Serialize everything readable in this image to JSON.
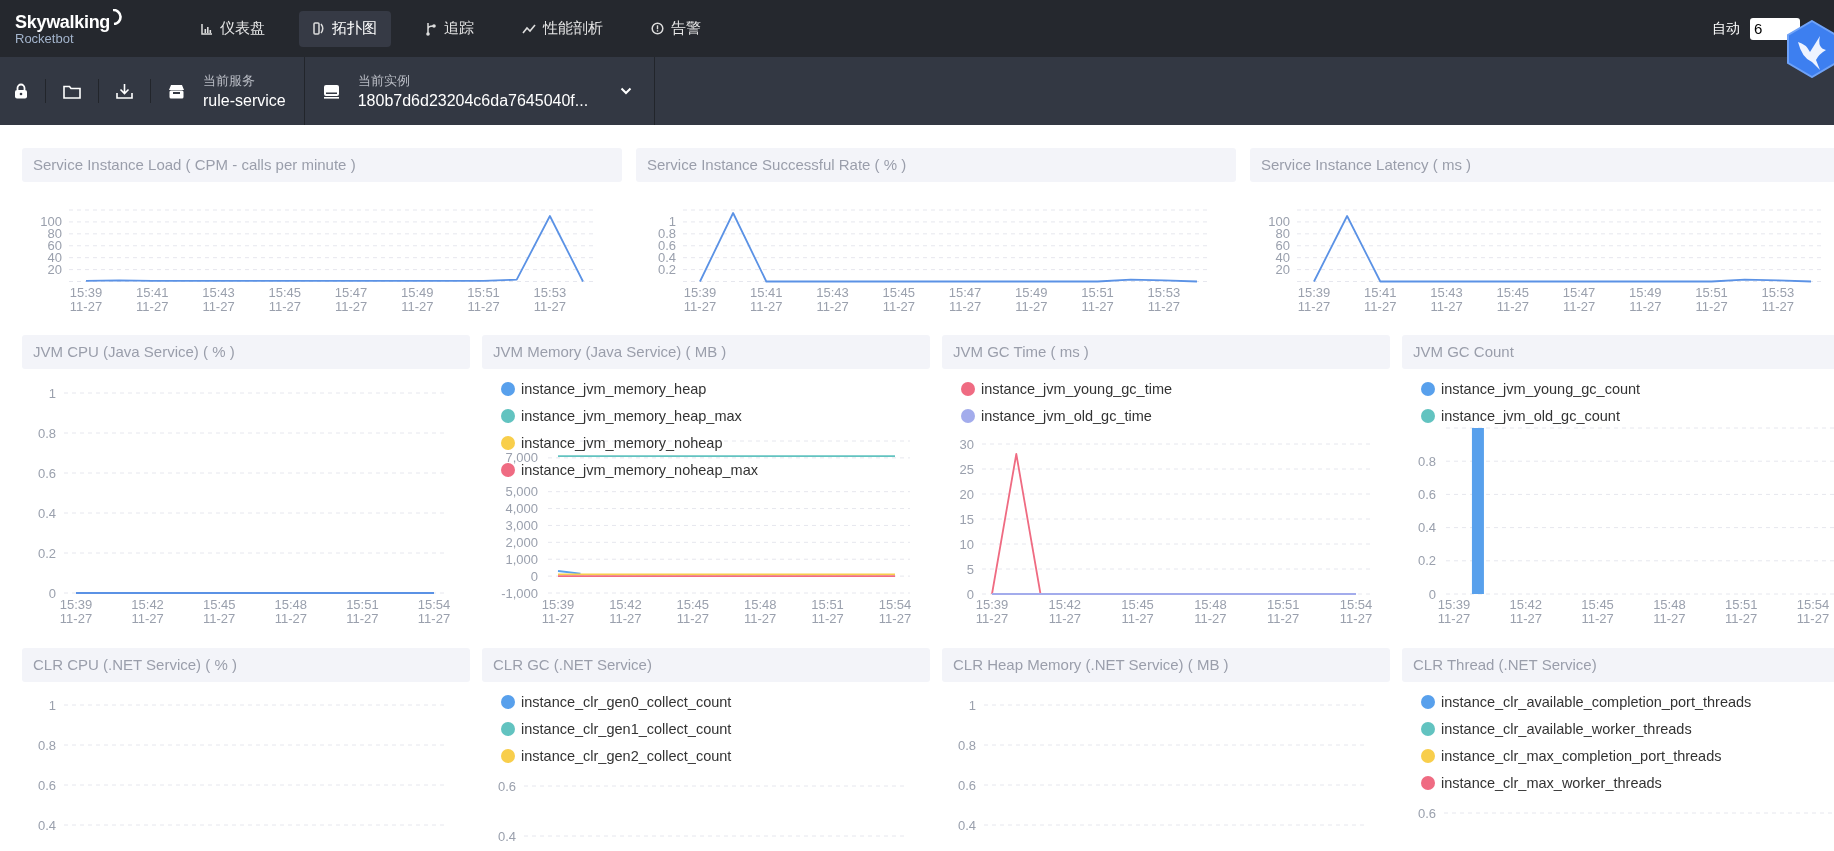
{
  "header": {
    "logo": "Skywalking",
    "subtitle": "Rocketbot",
    "nav": [
      {
        "kind": "dashboard",
        "label": "仪表盘",
        "selected": false
      },
      {
        "kind": "topology",
        "label": "拓扑图",
        "selected": true
      },
      {
        "kind": "trace",
        "label": "追踪",
        "selected": false
      },
      {
        "kind": "profile",
        "label": "性能剖析",
        "selected": false
      },
      {
        "kind": "alarm",
        "label": "告警",
        "selected": false
      }
    ],
    "auto_label": "自动",
    "auto_value": "6"
  },
  "toolbar": {
    "service_label": "当前服务",
    "service": "rule-service",
    "instance_label": "当前实例",
    "instance": "180b7d6d23204c6da7645040f..."
  },
  "rows": [
    {
      "panels": [
        {
          "title": "Service Instance Load ( CPM - calls per minute )",
          "chart_data": {
            "type": "line",
            "grid": true,
            "categories": [
              "15:39\n11-27",
              null,
              "15:41\n11-27",
              null,
              "15:43\n11-27",
              null,
              "15:45\n11-27",
              null,
              "15:47\n11-27",
              null,
              "15:49\n11-27",
              null,
              "15:51\n11-27",
              null,
              "15:53\n11-27",
              null
            ],
            "ylim": [
              0,
              120
            ],
            "yticks": [
              20,
              40,
              60,
              80,
              100
            ],
            "series": [
              {
                "color": "#5b92e5",
                "values": [
                  1,
                  2,
                  1,
                  1,
                  1,
                  1,
                  1,
                  1,
                  1,
                  1,
                  1,
                  1,
                  1,
                  3,
                  110,
                  0
                ]
              }
            ]
          }
        },
        {
          "title": "Service Instance Successful Rate ( % )",
          "chart_data": {
            "type": "line",
            "grid": true,
            "categories": [
              "15:39\n11-27",
              null,
              "15:41\n11-27",
              null,
              "15:43\n11-27",
              null,
              "15:45\n11-27",
              null,
              "15:47\n11-27",
              null,
              "15:49\n11-27",
              null,
              "15:51\n11-27",
              null,
              "15:53\n11-27",
              null
            ],
            "ylim": [
              0,
              1.2
            ],
            "yticks": [
              0.2,
              0.4,
              0.6,
              0.8,
              1
            ],
            "series": [
              {
                "color": "#5b92e5",
                "values": [
                  0,
                  1.15,
                  0,
                  0,
                  0,
                  0,
                  0,
                  0,
                  0,
                  0,
                  0,
                  0,
                  0,
                  0.03,
                  0.02,
                  0
                ]
              }
            ]
          }
        },
        {
          "title": "Service Instance Latency ( ms )",
          "chart_data": {
            "type": "line",
            "grid": true,
            "categories": [
              "15:39\n11-27",
              null,
              "15:41\n11-27",
              null,
              "15:43\n11-27",
              null,
              "15:45\n11-27",
              null,
              "15:47\n11-27",
              null,
              "15:49\n11-27",
              null,
              "15:51\n11-27",
              null,
              "15:53\n11-27",
              null
            ],
            "ylim": [
              0,
              120
            ],
            "yticks": [
              20,
              40,
              60,
              80,
              100
            ],
            "series": [
              {
                "color": "#5b92e5",
                "values": [
                  0,
                  110,
                  0,
                  0,
                  0,
                  0,
                  0,
                  0,
                  0,
                  0,
                  0,
                  0,
                  0,
                  3,
                  2,
                  0
                ]
              }
            ]
          }
        }
      ]
    },
    {
      "panels": [
        {
          "title": "JVM CPU (Java Service) ( % )",
          "chart_data": {
            "type": "line",
            "grid": true,
            "categories": [
              "15:39\n11-27",
              null,
              null,
              "15:42\n11-27",
              null,
              null,
              "15:45\n11-27",
              null,
              null,
              "15:48\n11-27",
              null,
              null,
              "15:51\n11-27",
              null,
              null,
              "15:54\n11-27"
            ],
            "ylim": [
              0,
              1
            ],
            "yticks": [
              0,
              0.2,
              0.4,
              0.6,
              0.8,
              1
            ],
            "series": [
              {
                "color": "#5b92e5",
                "values": [
                  0,
                  0,
                  0,
                  0,
                  0,
                  0,
                  0,
                  0,
                  0,
                  0,
                  0,
                  0,
                  0,
                  0,
                  0,
                  0
                ]
              }
            ]
          }
        },
        {
          "title": "JVM Memory (Java Service) ( MB )",
          "chart_data": {
            "type": "line",
            "grid": true,
            "categories": [
              "15:39\n11-27",
              null,
              null,
              "15:42\n11-27",
              null,
              null,
              "15:45\n11-27",
              null,
              null,
              "15:48\n11-27",
              null,
              null,
              "15:51\n11-27",
              null,
              null,
              "15:54\n11-27"
            ],
            "ylim": [
              -1000,
              8000
            ],
            "yticks": [
              {
                "value": -1000,
                "label": "-1,000"
              },
              0,
              {
                "value": 1000,
                "label": "1,000"
              },
              {
                "value": 2000,
                "label": "2,000"
              },
              {
                "value": 3000,
                "label": "3,000"
              },
              {
                "value": 4000,
                "label": "4,000"
              },
              {
                "value": 5000,
                "label": "5,000"
              },
              {
                "value": 7000,
                "label": "7,000"
              }
            ],
            "series": [
              {
                "name": "instance_jvm_memory_heap",
                "color": "#58a0ec",
                "values": [
                  300,
                  150,
                  null,
                  null,
                  null,
                  null,
                  null,
                  null,
                  null,
                  null,
                  null,
                  null,
                  null,
                  null,
                  null,
                  null
                ]
              },
              {
                "name": "instance_jvm_memory_heap_max",
                "color": "#62c3c0",
                "values": [
                  7100,
                  7100,
                  7100,
                  7100,
                  7100,
                  7100,
                  7100,
                  7100,
                  7100,
                  7100,
                  7100,
                  7100,
                  7100,
                  7100,
                  7100,
                  7100
                ]
              },
              {
                "name": "instance_jvm_memory_noheap",
                "color": "#f8ce4b",
                "values": [
                  100,
                  100,
                  100,
                  100,
                  100,
                  100,
                  100,
                  100,
                  100,
                  100,
                  100,
                  100,
                  100,
                  100,
                  100,
                  100
                ]
              },
              {
                "name": "instance_jvm_memory_noheap_max",
                "color": "#ef6b82",
                "values": [
                  0,
                  0,
                  0,
                  0,
                  0,
                  0,
                  0,
                  0,
                  0,
                  0,
                  0,
                  0,
                  0,
                  0,
                  0,
                  0
                ]
              }
            ]
          }
        },
        {
          "title": "JVM GC Time ( ms )",
          "chart_data": {
            "type": "line",
            "grid": true,
            "categories": [
              "15:39\n11-27",
              null,
              null,
              "15:42\n11-27",
              null,
              null,
              "15:45\n11-27",
              null,
              null,
              "15:48\n11-27",
              null,
              null,
              "15:51\n11-27",
              null,
              null,
              "15:54\n11-27"
            ],
            "ylim": [
              0,
              30
            ],
            "yticks": [
              0,
              5,
              10,
              15,
              20,
              25,
              30
            ],
            "series": [
              {
                "name": "instance_jvm_young_gc_time",
                "color": "#ef6b82",
                "values": [
                  0,
                  28,
                  0,
                  null,
                  null,
                  null,
                  null,
                  null,
                  null,
                  null,
                  null,
                  null,
                  null,
                  null,
                  null,
                  null
                ]
              },
              {
                "name": "instance_jvm_old_gc_time",
                "color": "#a3acec",
                "values": [
                  0,
                  0,
                  0,
                  0,
                  0,
                  0,
                  0,
                  0,
                  0,
                  0,
                  0,
                  0,
                  0,
                  0,
                  0,
                  0
                ]
              }
            ]
          }
        },
        {
          "title": "JVM GC Count",
          "chart_data": {
            "type": "bar",
            "grid": true,
            "categories": [
              "15:39\n11-27",
              null,
              null,
              "15:42\n11-27",
              null,
              null,
              "15:45\n11-27",
              null,
              null,
              "15:48\n11-27",
              null,
              null,
              "15:51\n11-27",
              null,
              null,
              "15:54\n11-27"
            ],
            "ylim": [
              0,
              1
            ],
            "yticks": [
              0,
              0.2,
              0.4,
              0.6,
              0.8
            ],
            "series": [
              {
                "name": "instance_jvm_young_gc_count",
                "color": "#58a0ec",
                "values": [
                  0,
                  1,
                  0,
                  0,
                  0,
                  0,
                  0,
                  0,
                  0,
                  0,
                  0,
                  0,
                  0,
                  0,
                  0,
                  0
                ]
              },
              {
                "name": "instance_jvm_old_gc_count",
                "color": "#62c3c0",
                "values": [
                  0,
                  0,
                  0,
                  0,
                  0,
                  0,
                  0,
                  0,
                  0,
                  0,
                  0,
                  0,
                  0,
                  0,
                  0,
                  0
                ]
              }
            ]
          }
        }
      ]
    },
    {
      "panels": [
        {
          "title": "CLR CPU (.NET Service) ( % )",
          "y_labels": [
            "1",
            "0.8",
            "0.6",
            "0.4"
          ]
        },
        {
          "title": "CLR GC (.NET Service)",
          "y_labels": [
            "0.6",
            "0.4"
          ],
          "legend": [
            {
              "name": "instance_clr_gen0_collect_count",
              "color": "#58a0ec"
            },
            {
              "name": "instance_clr_gen1_collect_count",
              "color": "#62c3c0"
            },
            {
              "name": "instance_clr_gen2_collect_count",
              "color": "#f8ce4b"
            }
          ]
        },
        {
          "title": "CLR Heap Memory (.NET Service) ( MB )",
          "y_labels": [
            "1",
            "0.8",
            "0.6",
            "0.4"
          ]
        },
        {
          "title": "CLR Thread (.NET Service)",
          "y_labels": [
            "0.6"
          ],
          "legend": [
            {
              "name": "instance_clr_available_completion_port_threads",
              "color": "#58a0ec"
            },
            {
              "name": "instance_clr_available_worker_threads",
              "color": "#62c3c0"
            },
            {
              "name": "instance_clr_max_completion_port_threads",
              "color": "#f8ce4b"
            },
            {
              "name": "instance_clr_max_worker_threads",
              "color": "#ef6b82"
            }
          ]
        }
      ]
    }
  ]
}
